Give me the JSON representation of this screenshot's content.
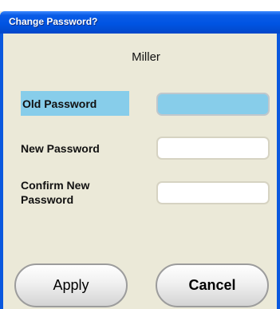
{
  "dialog": {
    "title": "Change Password?",
    "username": "Miller"
  },
  "fields": {
    "old_password_label": "Old Password",
    "new_password_label": "New Password",
    "confirm_password_label": "Confirm New Password",
    "old_password_value": "",
    "new_password_value": "",
    "confirm_password_value": ""
  },
  "buttons": {
    "apply_label": "Apply",
    "cancel_label": "Cancel"
  },
  "colors": {
    "title_bar": "#0054e3",
    "dialog_background": "#ebe9d8",
    "focus_highlight": "#87cdea"
  }
}
